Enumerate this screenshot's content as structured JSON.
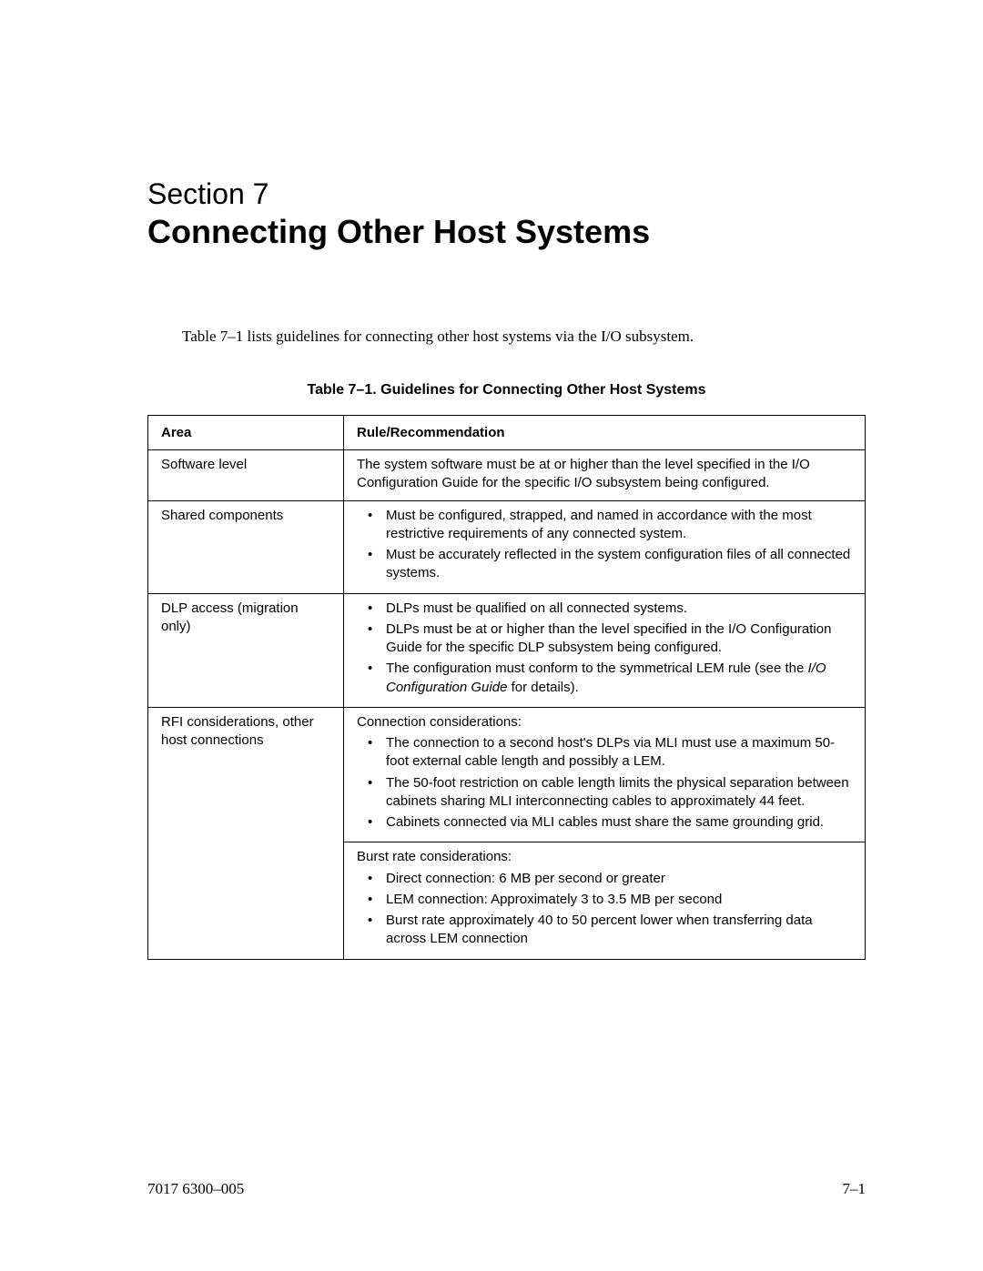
{
  "section_label": "Section 7",
  "section_title": "Connecting Other Host Systems",
  "intro": "Table 7–1 lists guidelines for connecting other host systems via the I/O subsystem.",
  "table_caption": "Table 7–1.  Guidelines for Connecting Other Host Systems",
  "headers": {
    "area": "Area",
    "rule": "Rule/Recommendation"
  },
  "rows": {
    "r1": {
      "area": "Software level",
      "text": "The system software must be at or higher than the level specified in the I/O Configuration Guide for the specific I/O subsystem being configured."
    },
    "r2": {
      "area": "Shared components",
      "b1": "Must be configured, strapped, and named in accordance with the most restrictive requirements of any connected system.",
      "b2": "Must be accurately reflected in the system configuration files of all connected systems."
    },
    "r3": {
      "area": "DLP access (migration only)",
      "b1": "DLPs must be qualified on all connected systems.",
      "b2": "DLPs must be at or higher than the level specified in the I/O Configuration Guide for the specific DLP subsystem being configured.",
      "b3a": "The configuration must conform to the symmetrical LEM rule (see the ",
      "b3i": "I/O Configuration Guide",
      "b3b": " for details)."
    },
    "r4": {
      "area": "RFI considerations, other host connections",
      "heading": "Connection considerations:",
      "b1": "The connection to a second host's DLPs via MLI must use a maximum 50-foot external cable length and possibly a LEM.",
      "b2": "The 50-foot restriction on cable length limits the physical separation between cabinets sharing MLI interconnecting cables to approximately 44 feet.",
      "b3": "Cabinets connected via MLI cables must share the same grounding grid."
    },
    "r5": {
      "heading": "Burst rate considerations:",
      "b1": "Direct connection: 6 MB per second or greater",
      "b2": "LEM connection: Approximately 3 to 3.5 MB per second",
      "b3": "Burst rate approximately 40 to 50 percent lower when transferring data across LEM connection"
    }
  },
  "footer": {
    "left": "7017 6300–005",
    "right": "7–1"
  }
}
